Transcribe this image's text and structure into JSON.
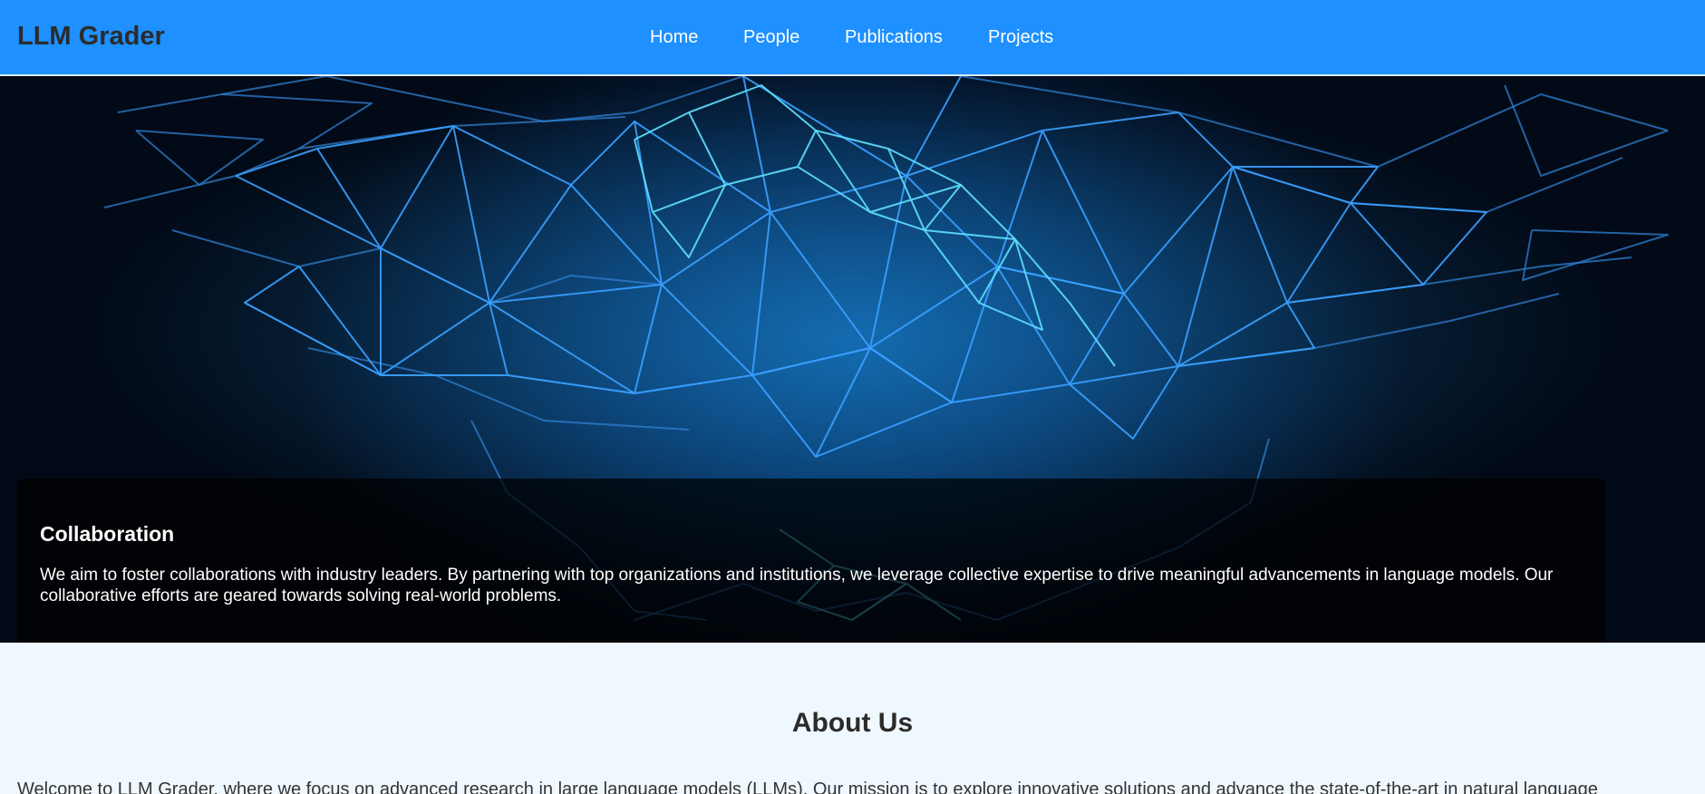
{
  "header": {
    "brand": "LLM Grader",
    "nav": [
      "Home",
      "People",
      "Publications",
      "Projects"
    ]
  },
  "hero": {
    "caption_title": "Collaboration",
    "caption_text": "We aim to foster collaborations with industry leaders. By partnering with top organizations and institutions, we leverage collective expertise to drive meaningful advancements in language models. Our collaborative efforts are geared towards solving real-world problems."
  },
  "about": {
    "title": "About Us",
    "text": "Welcome to LLM Grader, where we focus on advanced research in large language models (LLMs). Our mission is to explore innovative solutions and advance the state-of-the-art in natural language"
  },
  "colors": {
    "navbar": "#1e90ff",
    "page_background": "#f0f8ff",
    "mesh_line": "#3aa0ff",
    "mesh_highlight": "#5fe0ff"
  }
}
